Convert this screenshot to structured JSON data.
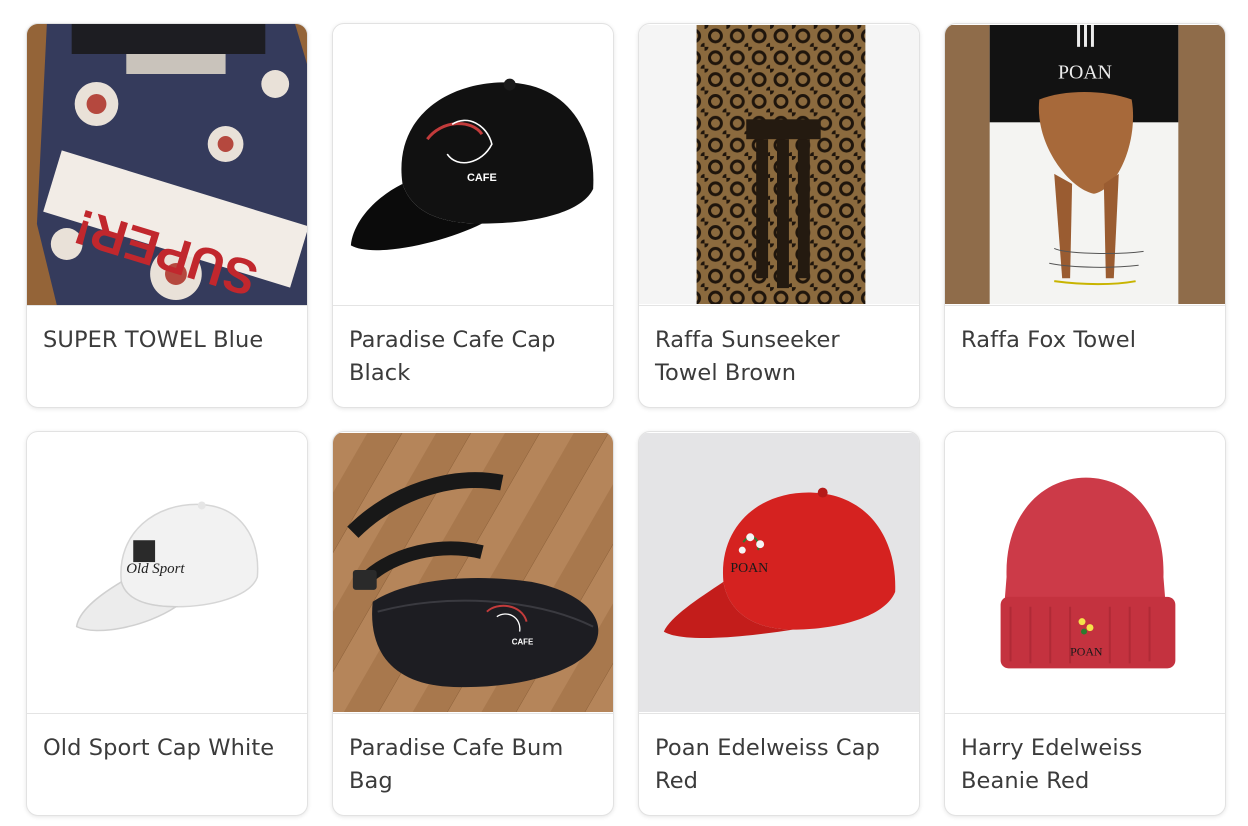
{
  "products": [
    {
      "name": "SUPER TOWEL Blue",
      "image_icon": "super-towel-image",
      "print_text": "SUPER!"
    },
    {
      "name": "Paradise Cafe Cap Black",
      "image_icon": "black-cap-image",
      "print_text": "CAFE"
    },
    {
      "name": "Raffa Sunseeker Towel Brown",
      "image_icon": "brown-towel-image"
    },
    {
      "name": "Raffa Fox Towel",
      "image_icon": "fox-towel-image",
      "print_text": "POAN"
    },
    {
      "name": "Old Sport Cap White",
      "image_icon": "white-cap-image",
      "print_text": "Old Sport"
    },
    {
      "name": "Paradise Cafe Bum Bag",
      "image_icon": "bum-bag-image",
      "print_text": "CAFE"
    },
    {
      "name": "Poan Edelweiss Cap Red",
      "image_icon": "red-cap-image",
      "print_text": "POAN"
    },
    {
      "name": "Harry Edelweiss Beanie Red",
      "image_icon": "red-beanie-image",
      "print_text": "POAN"
    }
  ]
}
